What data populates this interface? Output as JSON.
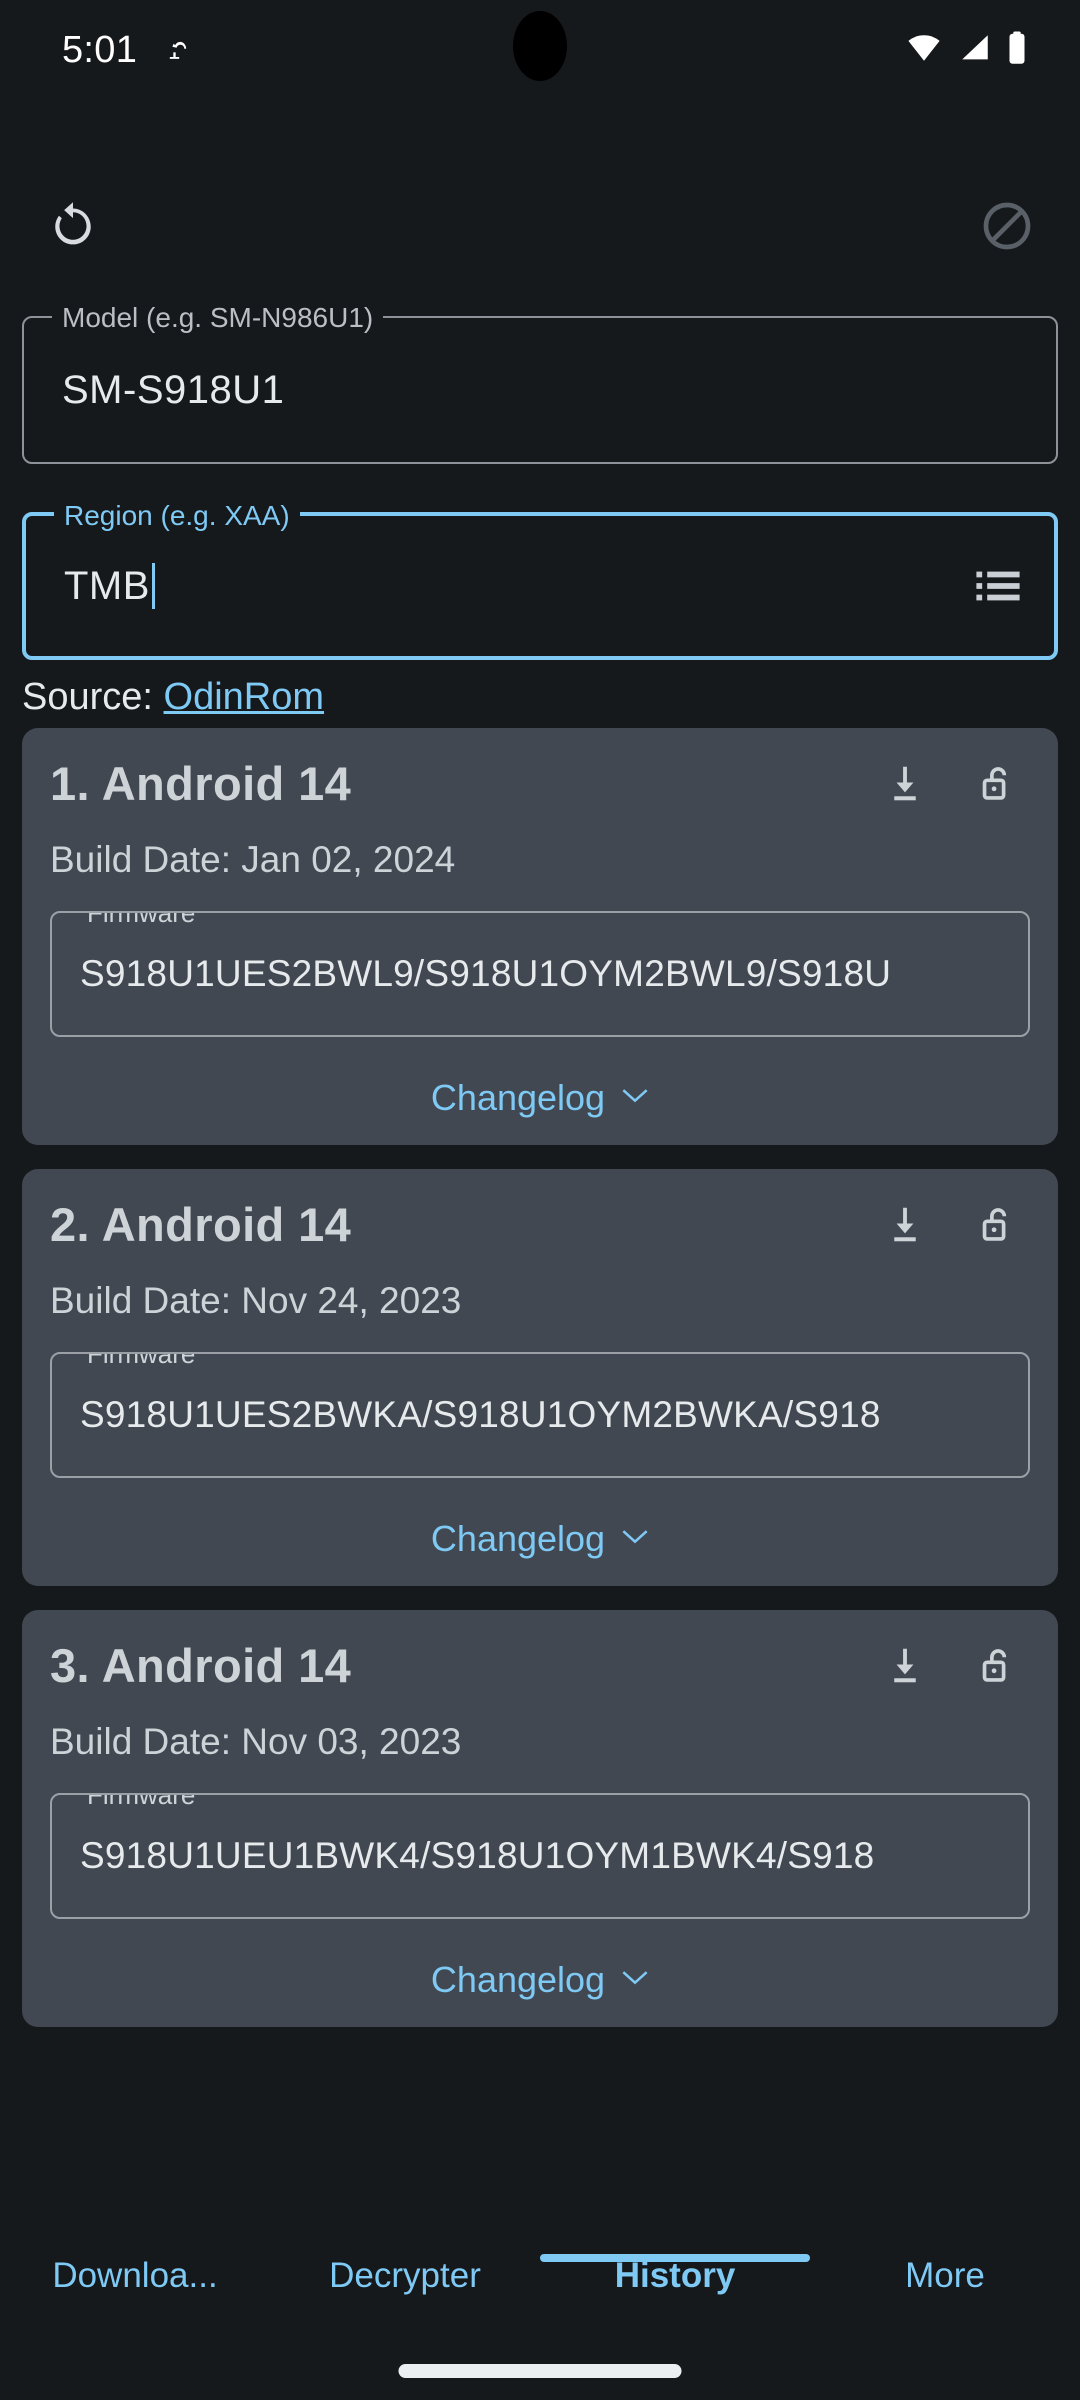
{
  "statusbar": {
    "time": "5:01",
    "notification_icon": "notification-icon",
    "wifi_icon": "wifi-icon",
    "signal_icon": "cell-signal-icon",
    "battery_icon": "battery-full-icon"
  },
  "toolbar": {
    "refresh_icon": "refresh-icon",
    "block_icon": "block-icon"
  },
  "model_field": {
    "label": "Model (e.g. SM-N986U1)",
    "value": "SM-S918U1",
    "placeholder": "SM-N986U1"
  },
  "region_field": {
    "label": "Region (e.g. XAA)",
    "value": "TMB",
    "placeholder": "XAA",
    "trailing_icon": "list-icon",
    "focused": true
  },
  "source": {
    "prefix": "Source:",
    "link_label": "OdinRom"
  },
  "firmware_cards": [
    {
      "title": "1. Android 14",
      "build_date_label": "Build Date: Jan 02, 2024",
      "firmware_label": "Firmware",
      "firmware_value": "S918U1UES2BWL9/S918U1OYM2BWL9/S918U",
      "changelog_label": "Changelog",
      "download_icon": "download-icon",
      "lock_icon": "unlock-icon",
      "chevron_icon": "chevron-down-icon"
    },
    {
      "title": "2. Android 14",
      "build_date_label": "Build Date: Nov 24, 2023",
      "firmware_label": "Firmware",
      "firmware_value": "S918U1UES2BWKA/S918U1OYM2BWKA/S918",
      "changelog_label": "Changelog",
      "download_icon": "download-icon",
      "lock_icon": "unlock-icon",
      "chevron_icon": "chevron-down-icon"
    },
    {
      "title": "3. Android 14",
      "build_date_label": "Build Date: Nov 03, 2023",
      "firmware_label": "Firmware",
      "firmware_value": "S918U1UEU1BWK4/S918U1OYM1BWK4/S918",
      "changelog_label": "Changelog",
      "download_icon": "download-icon",
      "lock_icon": "unlock-icon",
      "chevron_icon": "chevron-down-icon"
    }
  ],
  "bottom_nav": {
    "tabs": [
      {
        "label": "Downloa...",
        "active": false
      },
      {
        "label": "Decrypter",
        "active": false
      },
      {
        "label": "History",
        "active": true
      },
      {
        "label": "More",
        "active": false
      }
    ]
  },
  "colors": {
    "background": "#16191c",
    "card": "#414851",
    "accent": "#7fc9f5",
    "text_primary": "#e7eaec",
    "text_secondary": "#ced3d8",
    "outline": "#8d9399",
    "disabled_icon": "#5a6068"
  }
}
